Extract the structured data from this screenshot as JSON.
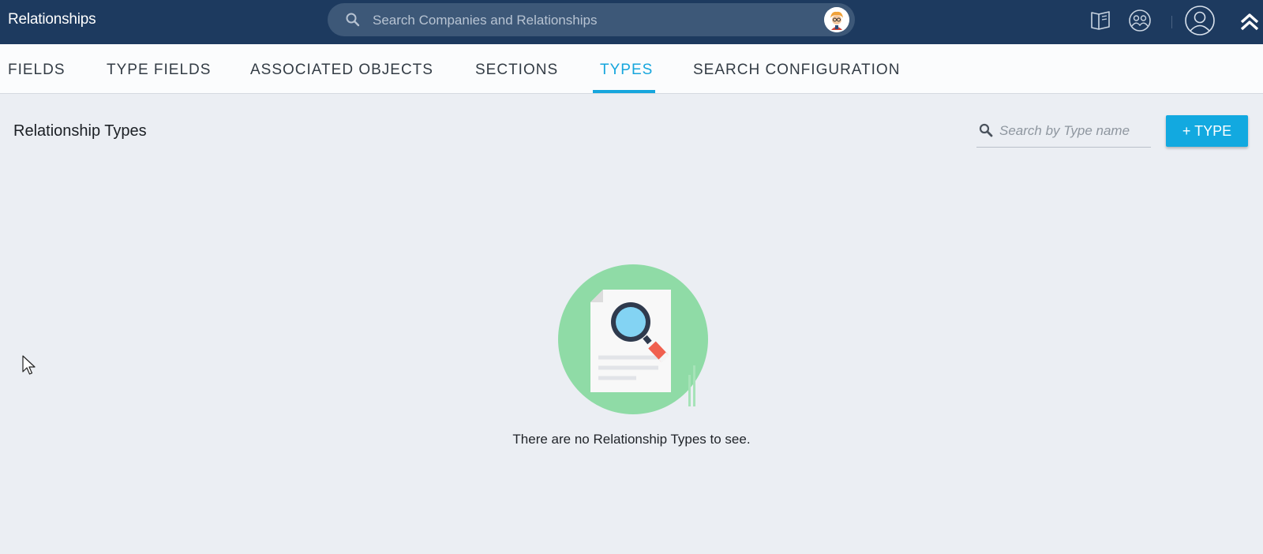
{
  "header": {
    "title": "Relationships",
    "search_placeholder": "Search Companies and Relationships",
    "icons": [
      "search-icon",
      "avatar",
      "book-icon",
      "community-icon",
      "user-profile-icon",
      "collapse-chevron-icon"
    ]
  },
  "tabs": [
    {
      "label": "FIELDS",
      "active": false
    },
    {
      "label": "TYPE FIELDS",
      "active": false
    },
    {
      "label": "ASSOCIATED OBJECTS",
      "active": false
    },
    {
      "label": "SECTIONS",
      "active": false
    },
    {
      "label": "TYPES",
      "active": true
    },
    {
      "label": "SEARCH CONFIGURATION",
      "active": false
    }
  ],
  "content": {
    "title": "Relationship Types",
    "search_placeholder": "Search by Type name",
    "add_button_label": "+ TYPE",
    "empty_message": "There are no Relationship Types to see."
  },
  "colors": {
    "header_bg": "#1d3a5f",
    "accent": "#16a6dd",
    "page_bg": "#ebeef3",
    "illustration_circle": "#8fdba6"
  }
}
